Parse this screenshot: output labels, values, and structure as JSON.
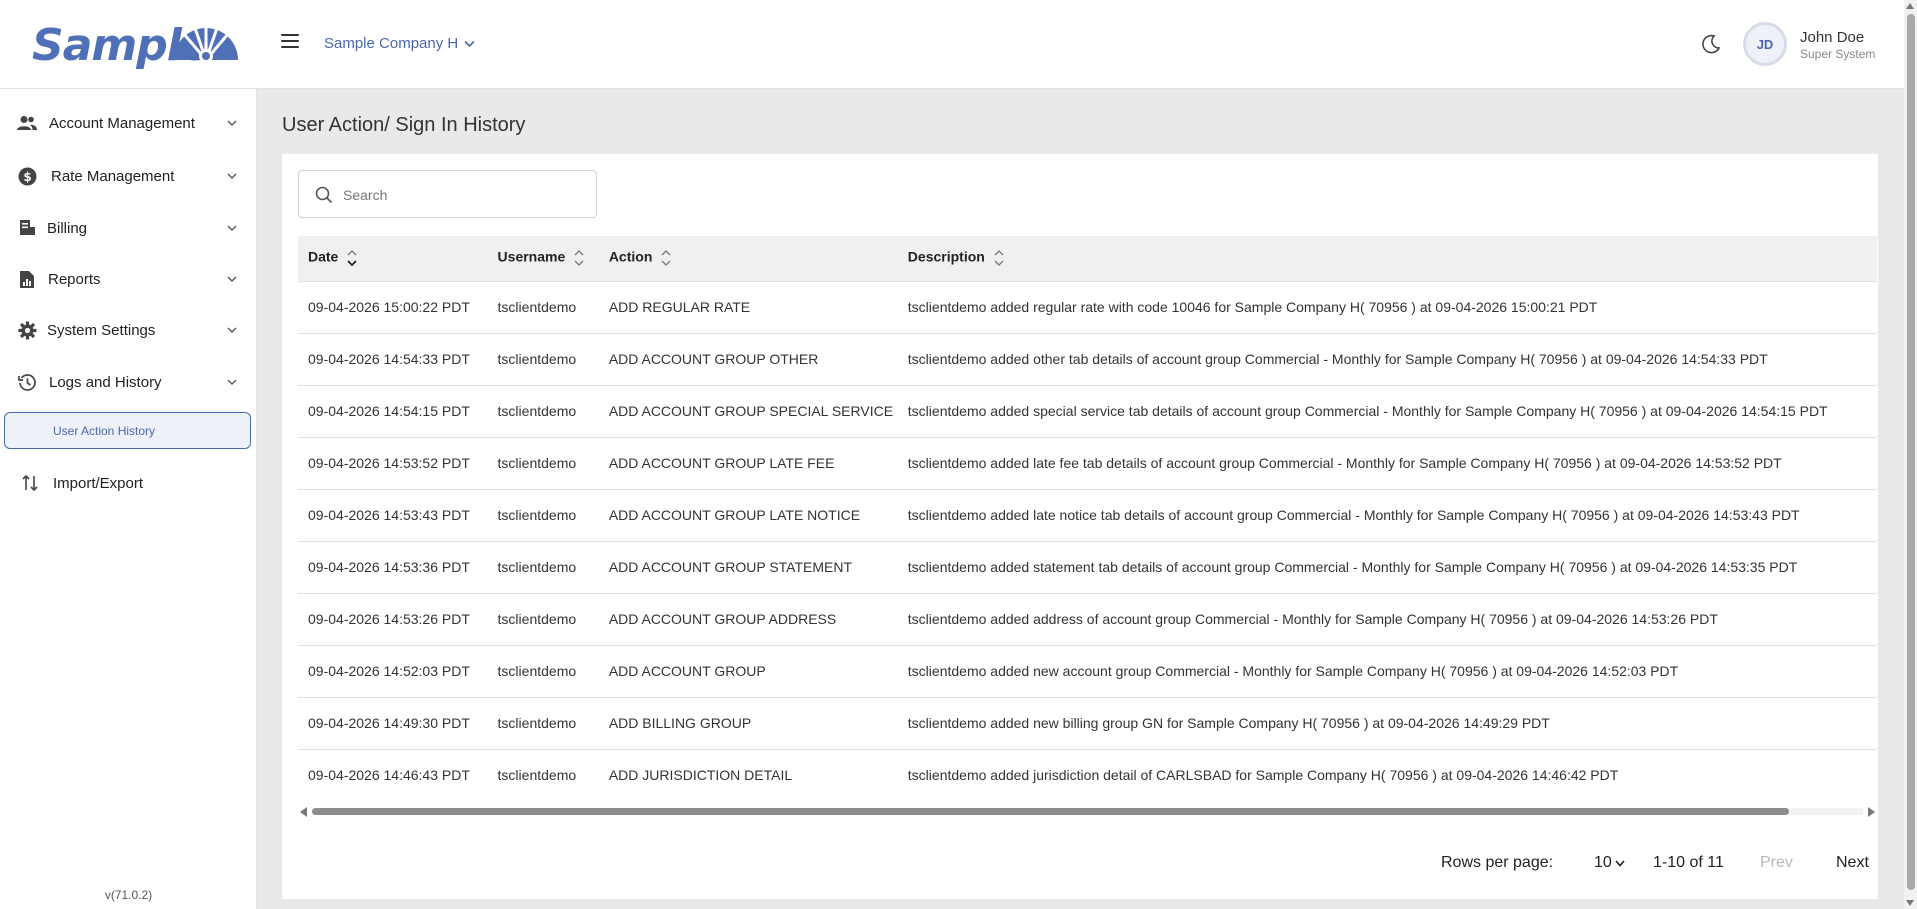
{
  "header": {
    "logo_text": "Sample",
    "company_selector": "Sample Company H",
    "user": {
      "initials": "JD",
      "name": "John Doe",
      "role": "Super System"
    }
  },
  "sidebar": {
    "items": [
      {
        "label": "Account Management",
        "icon": "users-icon"
      },
      {
        "label": "Rate Management",
        "icon": "dollar-circle-icon"
      },
      {
        "label": "Billing",
        "icon": "billing-icon"
      },
      {
        "label": "Reports",
        "icon": "report-file-icon"
      },
      {
        "label": "System Settings",
        "icon": "gear-icon"
      },
      {
        "label": "Logs and History",
        "icon": "history-icon"
      }
    ],
    "active_subitem": "User Action History",
    "import_export": "Import/Export",
    "version": "v(71.0.2)"
  },
  "main": {
    "title": "User Action/ Sign In History",
    "search": {
      "placeholder": "Search",
      "value": ""
    },
    "table": {
      "columns": [
        "Date",
        "Username",
        "Action",
        "Description"
      ],
      "rows": [
        [
          "09-04-2026 15:00:22 PDT",
          "tsclientdemo",
          "ADD REGULAR RATE",
          "tsclientdemo added regular rate with code 10046 for Sample Company H( 70956 ) at 09-04-2026 15:00:21 PDT"
        ],
        [
          "09-04-2026 14:54:33 PDT",
          "tsclientdemo",
          "ADD ACCOUNT GROUP OTHER",
          "tsclientdemo added other tab details of account group Commercial - Monthly for Sample Company H( 70956 ) at 09-04-2026 14:54:33 PDT"
        ],
        [
          "09-04-2026 14:54:15 PDT",
          "tsclientdemo",
          "ADD ACCOUNT GROUP SPECIAL SERVICE",
          "tsclientdemo added special service tab details of account group Commercial - Monthly for Sample Company H( 70956 ) at 09-04-2026 14:54:15 PDT"
        ],
        [
          "09-04-2026 14:53:52 PDT",
          "tsclientdemo",
          "ADD ACCOUNT GROUP LATE FEE",
          "tsclientdemo added late fee tab details of account group Commercial - Monthly for Sample Company H( 70956 ) at 09-04-2026 14:53:52 PDT"
        ],
        [
          "09-04-2026 14:53:43 PDT",
          "tsclientdemo",
          "ADD ACCOUNT GROUP LATE NOTICE",
          "tsclientdemo added late notice tab details of account group Commercial - Monthly for Sample Company H( 70956 ) at 09-04-2026 14:53:43 PDT"
        ],
        [
          "09-04-2026 14:53:36 PDT",
          "tsclientdemo",
          "ADD ACCOUNT GROUP STATEMENT",
          "tsclientdemo added statement tab details of account group Commercial - Monthly for Sample Company H( 70956 ) at 09-04-2026 14:53:35 PDT"
        ],
        [
          "09-04-2026 14:53:26 PDT",
          "tsclientdemo",
          "ADD ACCOUNT GROUP ADDRESS",
          "tsclientdemo added address of account group Commercial - Monthly for Sample Company H( 70956 ) at 09-04-2026 14:53:26 PDT"
        ],
        [
          "09-04-2026 14:52:03 PDT",
          "tsclientdemo",
          "ADD ACCOUNT GROUP",
          "tsclientdemo added new account group Commercial - Monthly for Sample Company H( 70956 ) at 09-04-2026 14:52:03 PDT"
        ],
        [
          "09-04-2026 14:49:30 PDT",
          "tsclientdemo",
          "ADD BILLING GROUP",
          "tsclientdemo added new billing group GN for Sample Company H( 70956 ) at 09-04-2026 14:49:29 PDT"
        ],
        [
          "09-04-2026 14:46:43 PDT",
          "tsclientdemo",
          "ADD JURISDICTION DETAIL",
          "tsclientdemo added jurisdiction detail of CARLSBAD for Sample Company H( 70956 ) at 09-04-2026 14:46:42 PDT"
        ]
      ]
    },
    "pagination": {
      "rows_per_page_label": "Rows per page:",
      "rows_per_page": "10",
      "range": "1-10 of 11",
      "prev": "Prev",
      "next": "Next"
    }
  },
  "colors": {
    "accent": "#4a68ad",
    "background": "#e9e9e9",
    "header_row": "#f0f0f0"
  }
}
